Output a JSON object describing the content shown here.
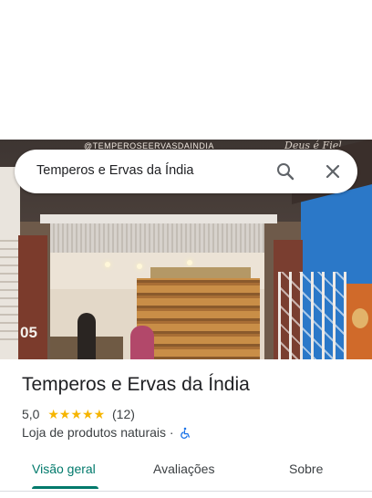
{
  "search": {
    "query": "Temperos e Ervas da Índia"
  },
  "photo": {
    "sign_text": "@TEMPEROSEERVASDAINDIA",
    "number": "05",
    "script_sign": "Deus é Fiel"
  },
  "place": {
    "name": "Temperos e Ervas da Índia",
    "rating": "5,0",
    "stars": "★★★★★",
    "review_count": "(12)",
    "category": "Loja de produtos naturais",
    "separator": "·"
  },
  "tabs": [
    {
      "label": "Visão geral",
      "active": true
    },
    {
      "label": "Avaliações",
      "active": false
    },
    {
      "label": "Sobre",
      "active": false
    }
  ],
  "colors": {
    "accent": "#00796b",
    "star": "#f6b500",
    "accessibility": "#1a73e8"
  },
  "icons": {
    "search": "search-icon",
    "close": "close-icon",
    "accessibility": "wheelchair-icon"
  }
}
